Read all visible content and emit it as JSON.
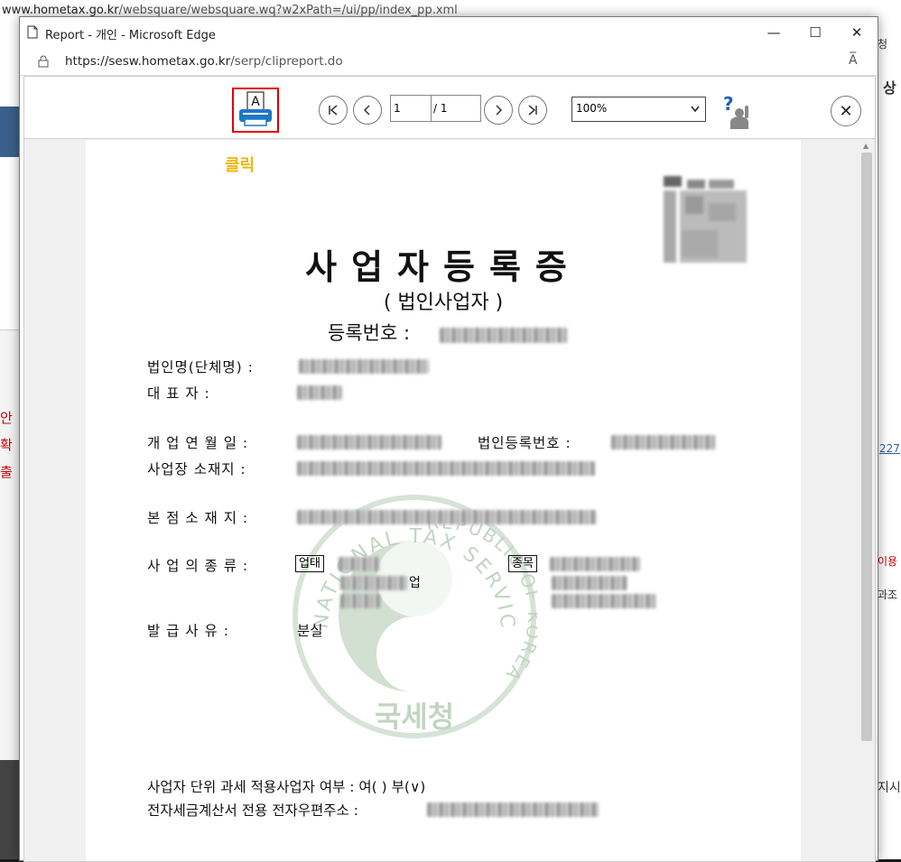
{
  "background": {
    "url_host": "www.hometax.go.kr",
    "url_path": "/websquare/websquare.wq?w2xPath=/ui/pp/index_pp.xml",
    "red_text": [
      "안",
      "확",
      "출"
    ],
    "right_snippets": [
      "청",
      "상",
      "227",
      "이용",
      "과조",
      "지시"
    ]
  },
  "window": {
    "title": "Report - 개인 - Microsoft Edge",
    "minimize": "—",
    "maximize": "☐",
    "close": "✕",
    "address_host": "https://sesw.hometax.go.kr",
    "address_path": "/serp/clipreport.do",
    "read_aloud": "A̅"
  },
  "toolbar": {
    "page_current": "1",
    "page_total": "/ 1",
    "zoom": "100%",
    "zoom_arrow": "⌄",
    "help": "?",
    "first": "|<",
    "prev": "<",
    "next": ">",
    "last": ">|",
    "close": "✕"
  },
  "document": {
    "click_hint": "클릭",
    "title": "사업자등록증",
    "subtitle": "( 법인사업자 )",
    "regno_label": "등록번호 :",
    "fields": {
      "corp_name": "법인명(단체명) :",
      "rep": "대    표    자 :",
      "open_date": "개 업 연 월 일 :",
      "corp_reg_no": "법인등록번호 :",
      "location": "사업장 소재지 :",
      "hq": "본 점 소 재 지 :",
      "biz_type": "사 업 의   종 류 :",
      "biz_kind_box": "업태",
      "biz_item_box": "종목",
      "biz_partial": "업",
      "issue_reason": "발  급  사  유 :",
      "issue_value": "분실",
      "unit_tax": "사업자 단위 과세 적용사업자 여부 : 여(   ) 부(∨)",
      "email": "전자세금계산서 전용 전자우편주소 :"
    },
    "seal_top": "NATIONAL TAX SERVICE",
    "seal_right": "REPUBLIC OF KOREA",
    "seal_bottom": "국세청"
  }
}
